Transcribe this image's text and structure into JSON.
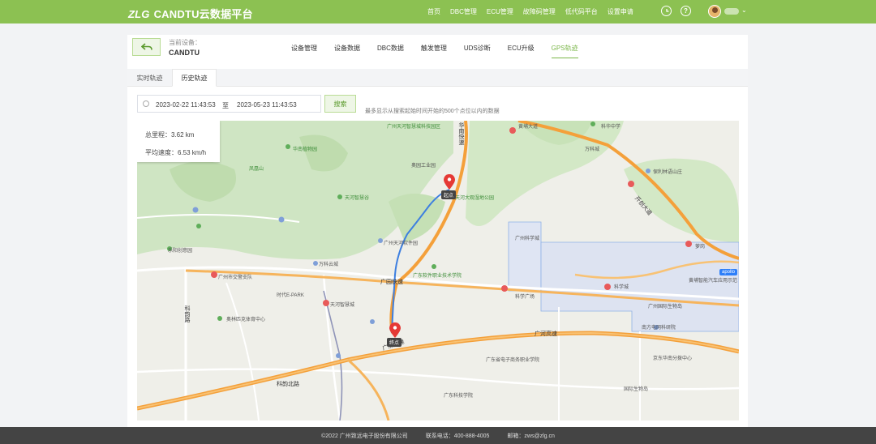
{
  "header": {
    "logo": "ZLG",
    "title": "CANDTU云数据平台",
    "nav": [
      "首页",
      "DBC管理",
      "ECU管理",
      "故障码管理",
      "低代码平台",
      "设置申请"
    ],
    "icons": [
      "clock-icon",
      "help-icon"
    ]
  },
  "device": {
    "label": "当前设备：",
    "name": "CANDTU"
  },
  "tabs": [
    "设备管理",
    "设备数据",
    "DBC数据",
    "触发管理",
    "UDS诊断",
    "ECU升级",
    "GPS轨迹"
  ],
  "active_tab": "GPS轨迹",
  "subtabs": [
    "实时轨迹",
    "历史轨迹"
  ],
  "active_subtab": "历史轨迹",
  "filter": {
    "start": "2023-02-22 11:43:53",
    "separator": "至",
    "end": "2023-05-23 11:43:53",
    "search_label": "搜索",
    "hint": "最多显示从搜索起始时间开始的500个点位以内的数据"
  },
  "stats": {
    "distance": "总里程：3.62 km",
    "avg_speed": "平均速度：6.53 km/h"
  },
  "map": {
    "start_tag": "起点",
    "end_tag": "终点",
    "labels": {
      "l1": "广州天河智慧城科技园区",
      "l2": "华南植物园",
      "l3": "凤凰山",
      "l4": "天河智慧谷",
      "l5": "奥园工业园",
      "l6": "天河大观湿地公园",
      "l7": "广州天河软件园",
      "l8": "广东软件职业技术学院",
      "l9": "万科云城",
      "l10": "时代E-PARK",
      "l11": "天河智慧城",
      "l12": "广州市交警支队",
      "l13": "乐阳创意园",
      "l14": "科韵路",
      "l15": "广东省电子商务职业学院",
      "l16": "广州国际生物岛",
      "l17": "保利林语山庄",
      "l18": "科学城",
      "l19": "黄埔大道",
      "l20": "萝岗",
      "l21": "科学广场",
      "l22": "奥林匹克体育中心",
      "l23": "南方电网科研院",
      "l24": "京东华南分拨中心",
      "l25": "国际生物岛",
      "l26": "广州科学城",
      "l27": "黄埔智能汽车应用示范",
      "l28": "万科城",
      "l29": "科华中学",
      "l30": "广东科技学院"
    },
    "roads": {
      "r1": "广深高速",
      "r2": "广河高速",
      "r3": "华南快速",
      "r4": "广园快速",
      "r5": "开创大道",
      "r6": "科韵北路"
    },
    "badge": "apollo"
  },
  "footer": {
    "copyright": "©2022 广州致远电子股份有限公司",
    "phone": "联系电话：400-888-4005",
    "email": "邮箱：zws@zlg.cn"
  }
}
